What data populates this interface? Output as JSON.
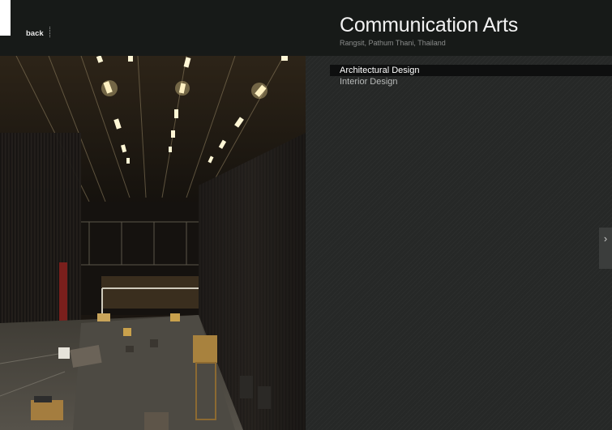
{
  "header": {
    "back_label": "back",
    "title": "Communication Arts",
    "subtitle": "Rangsit, Pathum Thani, Thailand"
  },
  "menu": {
    "items": [
      {
        "label": "Architectural Design",
        "active": true
      },
      {
        "label": "Interior Design",
        "active": false
      }
    ]
  },
  "nav": {
    "next_glyph": "›"
  },
  "photo": {
    "icon": "theater-stage-photo"
  },
  "colors": {
    "background": "#232524",
    "header": "#171a18",
    "active_item": "#0e0f0f"
  }
}
